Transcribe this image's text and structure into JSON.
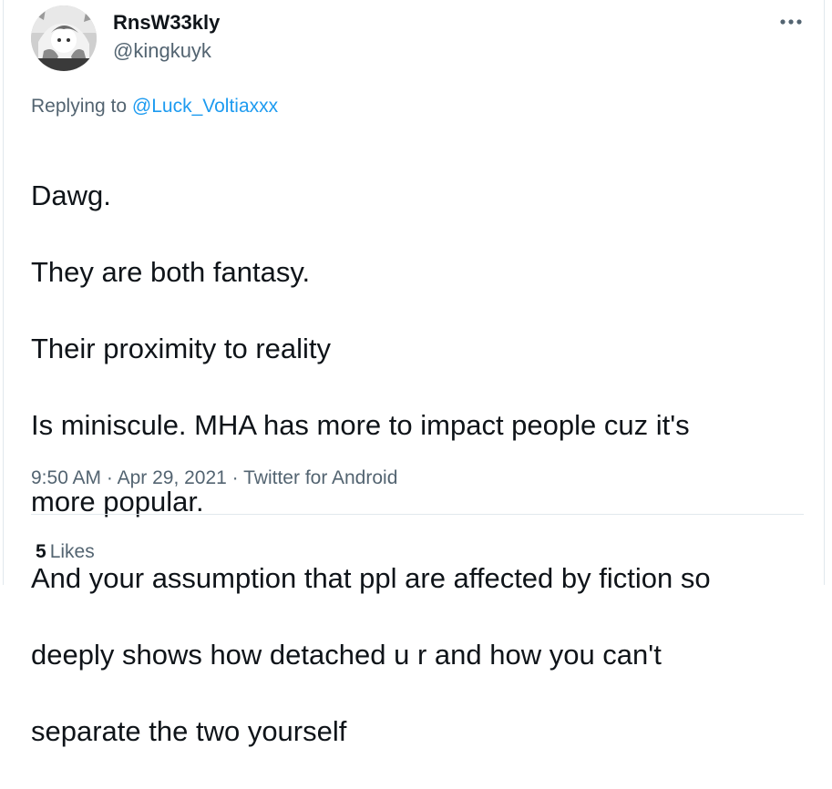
{
  "author": {
    "display_name": "RnsW33kly",
    "handle": "@kingkuyk",
    "avatar": "manga-avatar-image"
  },
  "menu": {
    "more_icon": "more-horizontal-icon"
  },
  "reply": {
    "prefix": "Replying to ",
    "mention": "@Luck_Voltiaxxx"
  },
  "tweet": {
    "lines": [
      "Dawg.",
      "They are both fantasy.",
      "Their proximity to reality",
      "Is miniscule. MHA has more to impact people cuz it's",
      "more popular.",
      "And your assumption that ppl are affected by fiction so",
      "deeply shows how detached u r and how you can't",
      "separate the two yourself"
    ]
  },
  "meta": {
    "time": "9:50 AM",
    "separator": " · ",
    "date": "Apr 29, 2021",
    "source": "Twitter for Android"
  },
  "stats": {
    "likes_count": "5",
    "likes_label": "Likes"
  },
  "colors": {
    "link": "#1d9bf0",
    "secondary_text": "#536471",
    "primary_text": "#0f1419",
    "divider": "#e1e8ed"
  }
}
